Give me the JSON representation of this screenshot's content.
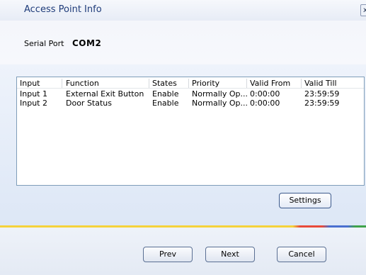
{
  "window": {
    "title": "Access Point Info",
    "close_glyph": "x"
  },
  "serial": {
    "label": "Serial Port",
    "value": "COM2"
  },
  "table": {
    "columns": [
      "Input",
      "Function",
      "States",
      "Priority",
      "Valid From",
      "Valid Till"
    ],
    "rows": [
      [
        "Input 1",
        "External Exit Button",
        "Enable",
        "Normally Op...",
        "0:00:00",
        "23:59:59"
      ],
      [
        "Input 2",
        "Door Status",
        "Enable",
        "Normally Op...",
        "0:00:00",
        "23:59:59"
      ]
    ]
  },
  "buttons": {
    "settings": "Settings",
    "prev": "Prev",
    "next": "Next",
    "cancel": "Cancel"
  },
  "colors": {
    "title_text": "#1f3c7a",
    "listview_border": "#7f9db9",
    "accent_yellow": "#f5d23c"
  },
  "icons": {
    "close": "close-icon"
  }
}
